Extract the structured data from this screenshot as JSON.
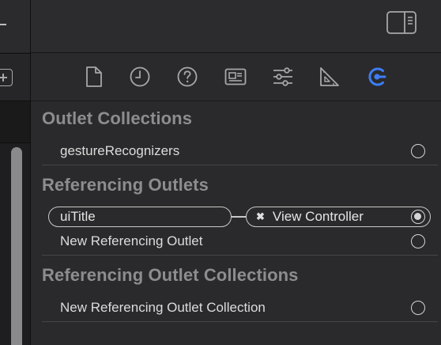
{
  "left_panel": {
    "add_icon": "plus-square-icon"
  },
  "toolbar": {
    "toggle_icon": "sidebar-right-icon"
  },
  "inspector_tabs": [
    {
      "icon": "file-icon"
    },
    {
      "icon": "clock-icon"
    },
    {
      "icon": "question-icon"
    },
    {
      "icon": "id-card-icon"
    },
    {
      "icon": "sliders-icon"
    },
    {
      "icon": "ruler-icon"
    },
    {
      "icon": "connections-icon",
      "active": true
    }
  ],
  "colors": {
    "active_accent": "#3d7df5",
    "icon_gray": "#a7a7aa",
    "section_title": "#8d8d90",
    "panel_bg": "#2a2a2c"
  },
  "sections": {
    "outlet_collections": {
      "title": "Outlet Collections",
      "items": [
        "gestureRecognizers"
      ]
    },
    "referencing_outlets": {
      "title": "Referencing Outlets",
      "connection": {
        "source": "uiTitle",
        "destination": "View Controller",
        "remove_glyph": "✖"
      },
      "new_label": "New Referencing Outlet"
    },
    "referencing_outlet_collections": {
      "title": "Referencing Outlet Collections",
      "new_label": "New Referencing Outlet Collection"
    }
  }
}
